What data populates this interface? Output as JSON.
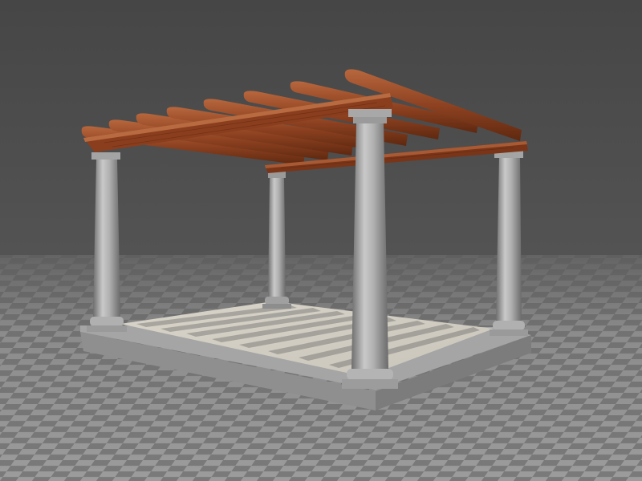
{
  "scene": {
    "subject": "pergola",
    "column_count": 4,
    "beam_count": 9,
    "colors": {
      "background_top": "#4a4a4a",
      "background_bottom": "#646464",
      "floor_light": "#a9a9a9",
      "floor_dark": "#6f6f6f",
      "stone": "#b5b5b5",
      "stone_shade": "#7d7d7d",
      "slab": "#b8b8b8",
      "tile": "#e4e0d6",
      "wood_light": "#b3623a",
      "wood_dark": "#6b2f14"
    }
  }
}
